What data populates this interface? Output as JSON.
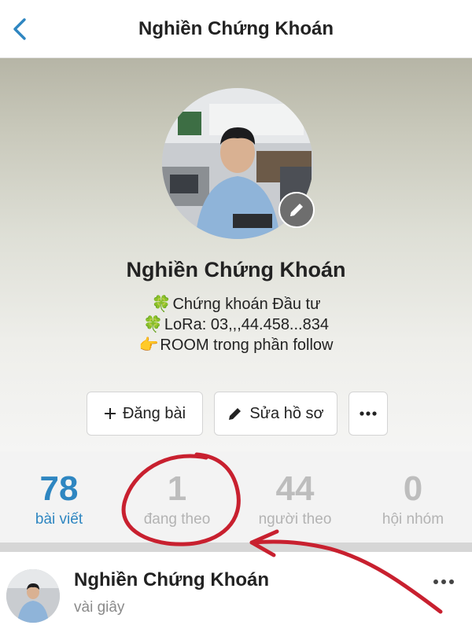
{
  "nav": {
    "title": "Nghiền Chứng Khoán",
    "back_icon": "chevron-left-icon"
  },
  "profile": {
    "name": "Nghiền Chứng Khoán",
    "bio": [
      {
        "icon": "🍀",
        "text": "Chứng khoán Đầu tư"
      },
      {
        "icon": "🍀",
        "text": "LoRa: 03,,,44.458...834"
      },
      {
        "icon": "👉",
        "text": " ROOM trong phần follow"
      }
    ],
    "edit_avatar_icon": "pencil-icon"
  },
  "actions": {
    "post_label": "Đăng bài",
    "edit_label": "Sửa hồ sơ",
    "more_icon": "more-horizontal-icon"
  },
  "stats": [
    {
      "value": "78",
      "label": "bài viết"
    },
    {
      "value": "1",
      "label": "đang theo"
    },
    {
      "value": "44",
      "label": "người theo"
    },
    {
      "value": "0",
      "label": "hội nhóm"
    }
  ],
  "post": {
    "author": "Nghiền Chứng Khoán",
    "time": "vài giây"
  },
  "colors": {
    "accent": "#2e86c1",
    "annotation": "#c8202f"
  }
}
